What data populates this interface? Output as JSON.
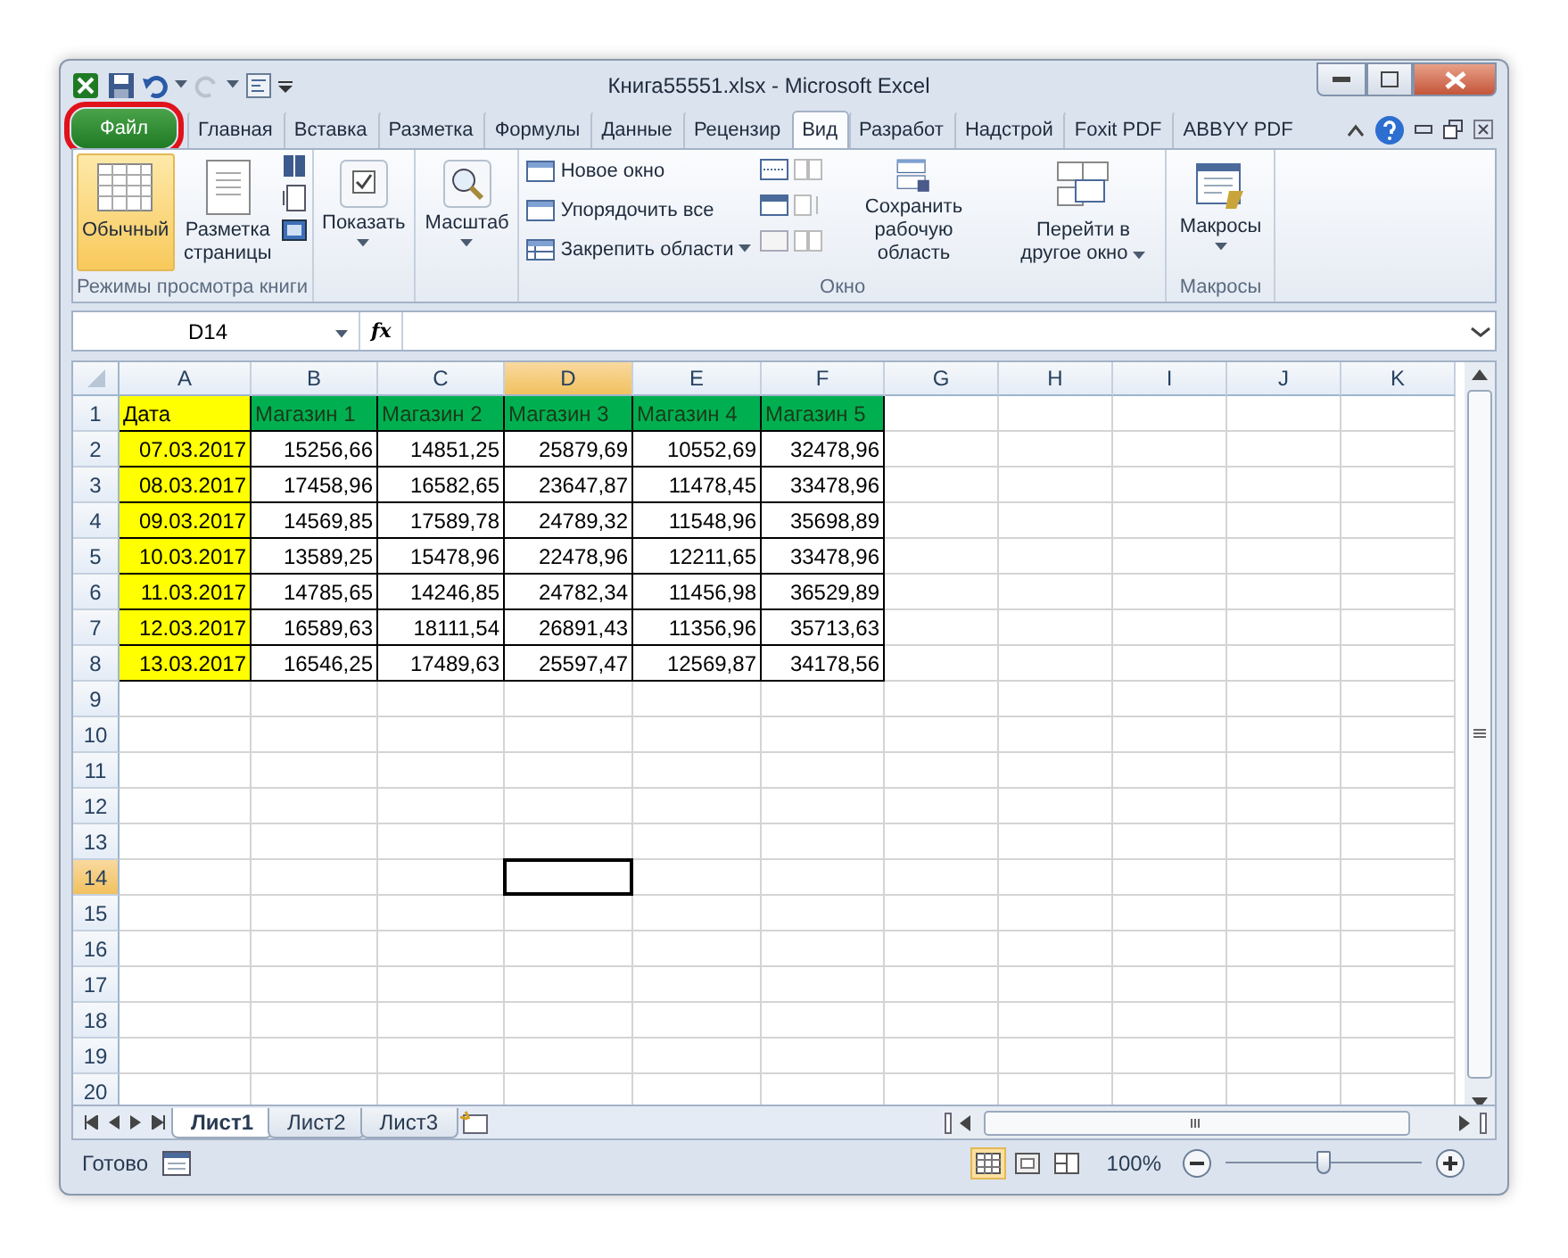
{
  "window": {
    "title": "Книга55551.xlsx - Microsoft Excel"
  },
  "ribbon_tabs": [
    {
      "label": "Файл",
      "kind": "file",
      "selected": false
    },
    {
      "label": "Главная",
      "kind": "tab",
      "selected": false
    },
    {
      "label": "Вставка",
      "kind": "tab",
      "selected": false
    },
    {
      "label": "Разметка",
      "kind": "tab",
      "selected": false
    },
    {
      "label": "Формулы",
      "kind": "tab",
      "selected": false
    },
    {
      "label": "Данные",
      "kind": "tab",
      "selected": false
    },
    {
      "label": "Рецензир",
      "kind": "tab",
      "selected": false
    },
    {
      "label": "Вид",
      "kind": "tab",
      "selected": true
    },
    {
      "label": "Разработ",
      "kind": "tab",
      "selected": false
    },
    {
      "label": "Надстрой",
      "kind": "tab",
      "selected": false
    },
    {
      "label": "Foxit PDF",
      "kind": "tab",
      "selected": false
    },
    {
      "label": "ABBYY PDF",
      "kind": "tab",
      "selected": false
    }
  ],
  "ribbon": {
    "view_modes": {
      "label": "Режимы просмотра книги",
      "normal": {
        "label": "Обычный",
        "selected": true
      },
      "page_layout": {
        "label": "Разметка страницы",
        "selected": false
      }
    },
    "show": {
      "label": "Показать"
    },
    "zoom": {
      "label": "Масштаб"
    },
    "window_group": {
      "label": "Окно",
      "commands": [
        "Новое окно",
        "Упорядочить все",
        "Закрепить области"
      ],
      "save_workspace": "Сохранить рабочую область",
      "switch_windows": "Перейти в другое окно"
    },
    "macros": {
      "label": "Макросы",
      "button": "Макросы"
    }
  },
  "formula_bar": {
    "name_box": "D14",
    "function_label": "fx"
  },
  "columns": [
    {
      "label": "A",
      "selected": false
    },
    {
      "label": "B",
      "selected": false
    },
    {
      "label": "C",
      "selected": false
    },
    {
      "label": "D",
      "selected": true
    },
    {
      "label": "E",
      "selected": false
    },
    {
      "label": "F",
      "selected": false
    },
    {
      "label": "G",
      "selected": false
    },
    {
      "label": "H",
      "selected": false
    },
    {
      "label": "I",
      "selected": false
    },
    {
      "label": "J",
      "selected": false
    },
    {
      "label": "K",
      "selected": false
    }
  ],
  "rows": [
    {
      "number": "1",
      "selected": false,
      "cells": [
        {
          "text": "Дата",
          "kind": "text",
          "color": "#ffff00"
        },
        {
          "text": "Магазин 1",
          "kind": "text",
          "color": "#00b050"
        },
        {
          "text": "Магазин 2",
          "kind": "text",
          "color": "#00b050"
        },
        {
          "text": "Магазин 3",
          "kind": "text",
          "color": "#00b050"
        },
        {
          "text": "Магазин 4",
          "kind": "text",
          "color": "#00b050"
        },
        {
          "text": "Магазин 5",
          "kind": "text",
          "color": "#00b050"
        }
      ]
    },
    {
      "number": "2",
      "selected": false,
      "cells": [
        {
          "text": "07.03.2017",
          "kind": "number",
          "color": "#ffff00"
        },
        {
          "text": "15256,66",
          "kind": "number"
        },
        {
          "text": "14851,25",
          "kind": "number"
        },
        {
          "text": "25879,69",
          "kind": "number"
        },
        {
          "text": "10552,69",
          "kind": "number"
        },
        {
          "text": "32478,96",
          "kind": "number"
        }
      ]
    },
    {
      "number": "3",
      "selected": false,
      "cells": [
        {
          "text": "08.03.2017",
          "kind": "number",
          "color": "#ffff00"
        },
        {
          "text": "17458,96",
          "kind": "number"
        },
        {
          "text": "16582,65",
          "kind": "number"
        },
        {
          "text": "23647,87",
          "kind": "number"
        },
        {
          "text": "11478,45",
          "kind": "number"
        },
        {
          "text": "33478,96",
          "kind": "number"
        }
      ]
    },
    {
      "number": "4",
      "selected": false,
      "cells": [
        {
          "text": "09.03.2017",
          "kind": "number",
          "color": "#ffff00"
        },
        {
          "text": "14569,85",
          "kind": "number"
        },
        {
          "text": "17589,78",
          "kind": "number"
        },
        {
          "text": "24789,32",
          "kind": "number"
        },
        {
          "text": "11548,96",
          "kind": "number"
        },
        {
          "text": "35698,89",
          "kind": "number"
        }
      ]
    },
    {
      "number": "5",
      "selected": false,
      "cells": [
        {
          "text": "10.03.2017",
          "kind": "number",
          "color": "#ffff00"
        },
        {
          "text": "13589,25",
          "kind": "number"
        },
        {
          "text": "15478,96",
          "kind": "number"
        },
        {
          "text": "22478,96",
          "kind": "number"
        },
        {
          "text": "12211,65",
          "kind": "number"
        },
        {
          "text": "33478,96",
          "kind": "number"
        }
      ]
    },
    {
      "number": "6",
      "selected": false,
      "cells": [
        {
          "text": "11.03.2017",
          "kind": "number",
          "color": "#ffff00"
        },
        {
          "text": "14785,65",
          "kind": "number"
        },
        {
          "text": "14246,85",
          "kind": "number"
        },
        {
          "text": "24782,34",
          "kind": "number"
        },
        {
          "text": "11456,98",
          "kind": "number"
        },
        {
          "text": "36529,89",
          "kind": "number"
        }
      ]
    },
    {
      "number": "7",
      "selected": false,
      "cells": [
        {
          "text": "12.03.2017",
          "kind": "number",
          "color": "#ffff00"
        },
        {
          "text": "16589,63",
          "kind": "number"
        },
        {
          "text": "18111,54",
          "kind": "number"
        },
        {
          "text": "26891,43",
          "kind": "number"
        },
        {
          "text": "11356,96",
          "kind": "number"
        },
        {
          "text": "35713,63",
          "kind": "number"
        }
      ]
    },
    {
      "number": "8",
      "selected": false,
      "cells": [
        {
          "text": "13.03.2017",
          "kind": "number",
          "color": "#ffff00"
        },
        {
          "text": "16546,25",
          "kind": "number"
        },
        {
          "text": "17489,63",
          "kind": "number"
        },
        {
          "text": "25597,47",
          "kind": "number"
        },
        {
          "text": "12569,87",
          "kind": "number"
        },
        {
          "text": "34178,56",
          "kind": "number"
        }
      ]
    },
    {
      "number": "9",
      "selected": false
    },
    {
      "number": "10",
      "selected": false
    },
    {
      "number": "11",
      "selected": false
    },
    {
      "number": "12",
      "selected": false
    },
    {
      "number": "13",
      "selected": false
    },
    {
      "number": "14",
      "selected": true
    },
    {
      "number": "15",
      "selected": false
    },
    {
      "number": "16",
      "selected": false
    },
    {
      "number": "17",
      "selected": false
    },
    {
      "number": "18",
      "selected": false
    },
    {
      "number": "19",
      "selected": false
    },
    {
      "number": "20",
      "selected": false
    }
  ],
  "sheet_tabs": [
    {
      "label": "Лист1",
      "selected": true
    },
    {
      "label": "Лист2",
      "selected": false
    },
    {
      "label": "Лист3",
      "selected": false
    }
  ],
  "status_bar": {
    "status": "Готово",
    "views": [
      {
        "kind": "normal",
        "selected": true
      },
      {
        "kind": "page_layout",
        "selected": false
      },
      {
        "kind": "page_break",
        "selected": false
      }
    ],
    "zoom": "100%",
    "zoom_level": {
      "level": 0.5
    }
  }
}
